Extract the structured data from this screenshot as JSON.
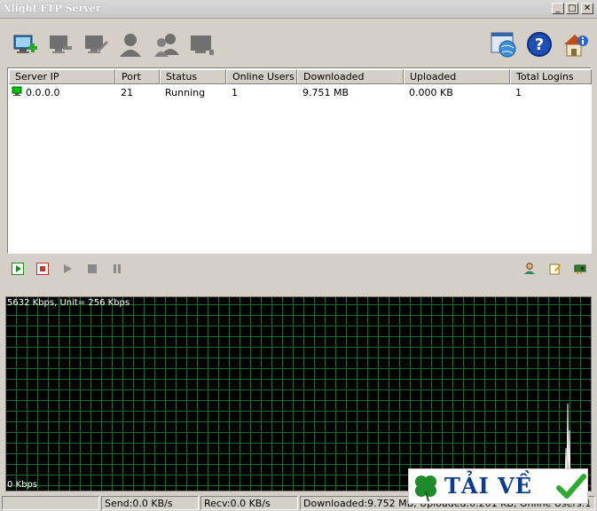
{
  "window": {
    "title": "Xlight FTP Server",
    "minimize": "_",
    "maximize": "□",
    "close": "✕"
  },
  "colors": {
    "grid": "#1b6b2a",
    "graph_bg": "#000000",
    "running": "#00c000",
    "trace": "#ffffff"
  },
  "list": {
    "columns": [
      "Server IP",
      "Port",
      "Status",
      "Online Users",
      "Downloaded",
      "Uploaded",
      "Total Logins"
    ],
    "rows": [
      {
        "ip": "0.0.0.0",
        "port": "21",
        "status": "Running",
        "online": "1",
        "downloaded": "9.751 MB",
        "uploaded": "0.000 KB",
        "logins": "1"
      }
    ]
  },
  "graph": {
    "top_label": "5632 Kbps, Unit= 256 Kbps",
    "bottom_label": "0 Kbps"
  },
  "status": {
    "send": "Send:0.0 KB/s",
    "recv": "Recv:0.0 KB/s",
    "summary": "Downloaded:9.752 MB, Uploaded:0.201 KB, Online Users:1"
  },
  "logo": {
    "text": "TẢI VỀ"
  }
}
